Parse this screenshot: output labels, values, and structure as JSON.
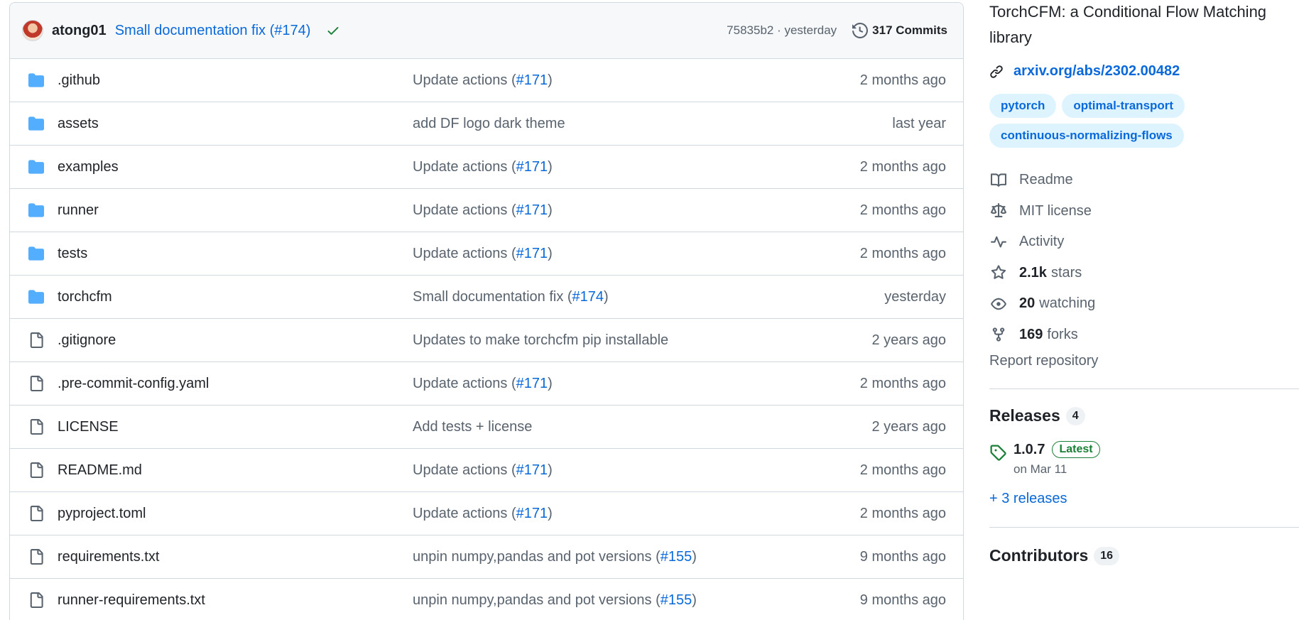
{
  "commit_bar": {
    "author": "atong01",
    "message": "Small documentation fix (#174)",
    "hash_time": "75835b2 · yesterday",
    "commits": "317 Commits"
  },
  "files": [
    {
      "name": ".github",
      "type": "dir",
      "msg": "Update actions (",
      "link": "#171",
      "tail": ")",
      "date": "2 months ago"
    },
    {
      "name": "assets",
      "type": "dir",
      "msg": "add DF logo dark theme",
      "link": "",
      "tail": "",
      "date": "last year"
    },
    {
      "name": "examples",
      "type": "dir",
      "msg": "Update actions (",
      "link": "#171",
      "tail": ")",
      "date": "2 months ago"
    },
    {
      "name": "runner",
      "type": "dir",
      "msg": "Update actions (",
      "link": "#171",
      "tail": ")",
      "date": "2 months ago"
    },
    {
      "name": "tests",
      "type": "dir",
      "msg": "Update actions (",
      "link": "#171",
      "tail": ")",
      "date": "2 months ago"
    },
    {
      "name": "torchcfm",
      "type": "dir",
      "msg": "Small documentation fix (",
      "link": "#174",
      "tail": ")",
      "date": "yesterday"
    },
    {
      "name": ".gitignore",
      "type": "file",
      "msg": "Updates to make torchcfm pip installable",
      "link": "",
      "tail": "",
      "date": "2 years ago"
    },
    {
      "name": ".pre-commit-config.yaml",
      "type": "file",
      "msg": "Update actions (",
      "link": "#171",
      "tail": ")",
      "date": "2 months ago"
    },
    {
      "name": "LICENSE",
      "type": "file",
      "msg": "Add tests + license",
      "link": "",
      "tail": "",
      "date": "2 years ago"
    },
    {
      "name": "README.md",
      "type": "file",
      "msg": "Update actions (",
      "link": "#171",
      "tail": ")",
      "date": "2 months ago"
    },
    {
      "name": "pyproject.toml",
      "type": "file",
      "msg": "Update actions (",
      "link": "#171",
      "tail": ")",
      "date": "2 months ago"
    },
    {
      "name": "requirements.txt",
      "type": "file",
      "msg": "unpin numpy,pandas and pot versions (",
      "link": "#155",
      "tail": ")",
      "date": "9 months ago"
    },
    {
      "name": "runner-requirements.txt",
      "type": "file",
      "msg": "unpin numpy,pandas and pot versions (",
      "link": "#155",
      "tail": ")",
      "date": "9 months ago"
    }
  ],
  "about": {
    "description": "TorchCFM: a Conditional Flow Matching library",
    "link": "arxiv.org/abs/2302.00482",
    "topics": [
      "pytorch",
      "optimal-transport",
      "continuous-normalizing-flows"
    ],
    "readme": "Readme",
    "license": "MIT license",
    "activity": "Activity",
    "stars_count": "2.1k",
    "stars_label": "stars",
    "watching_count": "20",
    "watching_label": "watching",
    "forks_count": "169",
    "forks_label": "forks",
    "report": "Report repository"
  },
  "releases": {
    "title": "Releases",
    "count": "4",
    "version": "1.0.7",
    "badge": "Latest",
    "date": "on Mar 11",
    "more": "+ 3 releases"
  },
  "contributors": {
    "title": "Contributors",
    "count": "16"
  },
  "colors": {
    "accent": "#0969da",
    "folder": "#54aeff",
    "success": "#1a7f37",
    "muted": "#59636e"
  }
}
